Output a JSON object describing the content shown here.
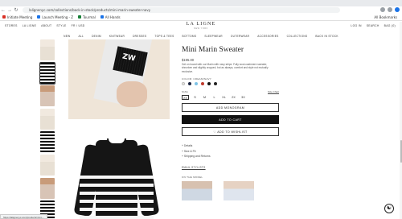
{
  "browser": {
    "url": "lalignenyc.com/collections/back-in-stock/products/mini-marin-sweater-navy",
    "bookmarks": [
      "Initiate Meeting",
      "Launch Meeting - Z",
      "Tourmal",
      "All Hands"
    ],
    "bookmarks_right": "All Bookmarks"
  },
  "site": {
    "logo": "LA LIGNE",
    "logo_sub": "NEW YORK",
    "top_left": [
      "STORES",
      "LA LIGNE",
      "ABOUT",
      "STYLE",
      "FR / USD"
    ],
    "top_right": [
      "LOG IN",
      "SEARCH",
      "BAG (0)"
    ],
    "categories": [
      "NEW",
      "ALL",
      "DENIM",
      "KNITWEAR",
      "DRESSES",
      "TOPS & TEES",
      "BOTTOMS",
      "SLEEPWEAR",
      "OUTERWEAR",
      "ACCESSORIES",
      "COLLECTIONS",
      "BACK IN STOCK"
    ]
  },
  "product": {
    "title": "Mini Marin Sweater",
    "price": "$195.00",
    "description": "Get on board with our Marin with navy stripe. Fully wool-cashmere sweater, shrunken and slightly cropped, but as always, comfort and style not mutually exclusive.",
    "color_label": "COLOR: CREAM/NAVY",
    "swatches": [
      "#f3efe6",
      "#1c2541",
      "#7ec3e6",
      "#c0392b",
      "#111111",
      "#222222"
    ],
    "size_label": "SIZE",
    "size_chart": "Size Chart",
    "sizes": [
      "XS",
      "S",
      "M",
      "L",
      "XL",
      "2X",
      "3X"
    ],
    "selected_size": "XS",
    "add_monogram": "ADD MONOGRAM",
    "add_to_cart": "ADD TO CART",
    "add_to_wishlist": "ADD TO WISHLIST",
    "details": [
      "+ Details",
      "+ Size & Fit",
      "+ Shipping and Returns"
    ],
    "email_stylists": "EMAIL STYLISTS",
    "on_the_model": "ON THE MODEL",
    "cuff_text": "ZW"
  },
  "status_url": "https://lalignenyc.com/products/mini-..."
}
